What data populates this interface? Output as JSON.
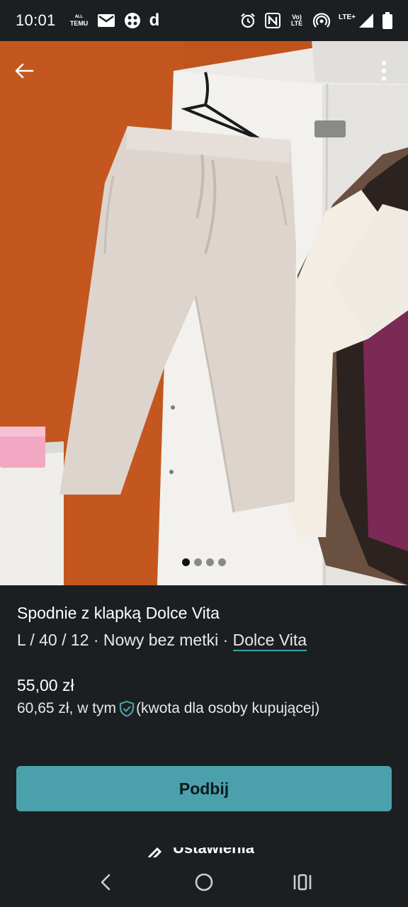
{
  "status_bar": {
    "time": "10:01",
    "left_icons": [
      "temu-icon",
      "gmail-icon",
      "app-icon",
      "d-icon"
    ],
    "temu_text": "ᴬᴸᴸ\nTEMU",
    "d_text": "d",
    "volte_text": "Vo)\nLTE",
    "lte_text": "LTE+",
    "right_icons": [
      "alarm-icon",
      "nfc-icon",
      "volte-icon",
      "hotspot-icon",
      "signal-icon",
      "battery-icon"
    ]
  },
  "listing": {
    "photo_count": 4,
    "active_photo": 1,
    "title": "Spodnie z klapką Dolce Vita",
    "meta_prefix": "L / 40 / 12 · Nowy bez metki · ",
    "brand": "Dolce Vita",
    "price": "55,00 zł",
    "total_price": "60,65 zł, w tym",
    "total_note": "(kwota dla osoby kupującej)"
  },
  "actions": {
    "bump_label": "Podbij",
    "partial_label": "Ustawienia"
  },
  "colors": {
    "accent": "#4aa0ab",
    "background": "#1b1f21",
    "wall": "#c1541c"
  }
}
